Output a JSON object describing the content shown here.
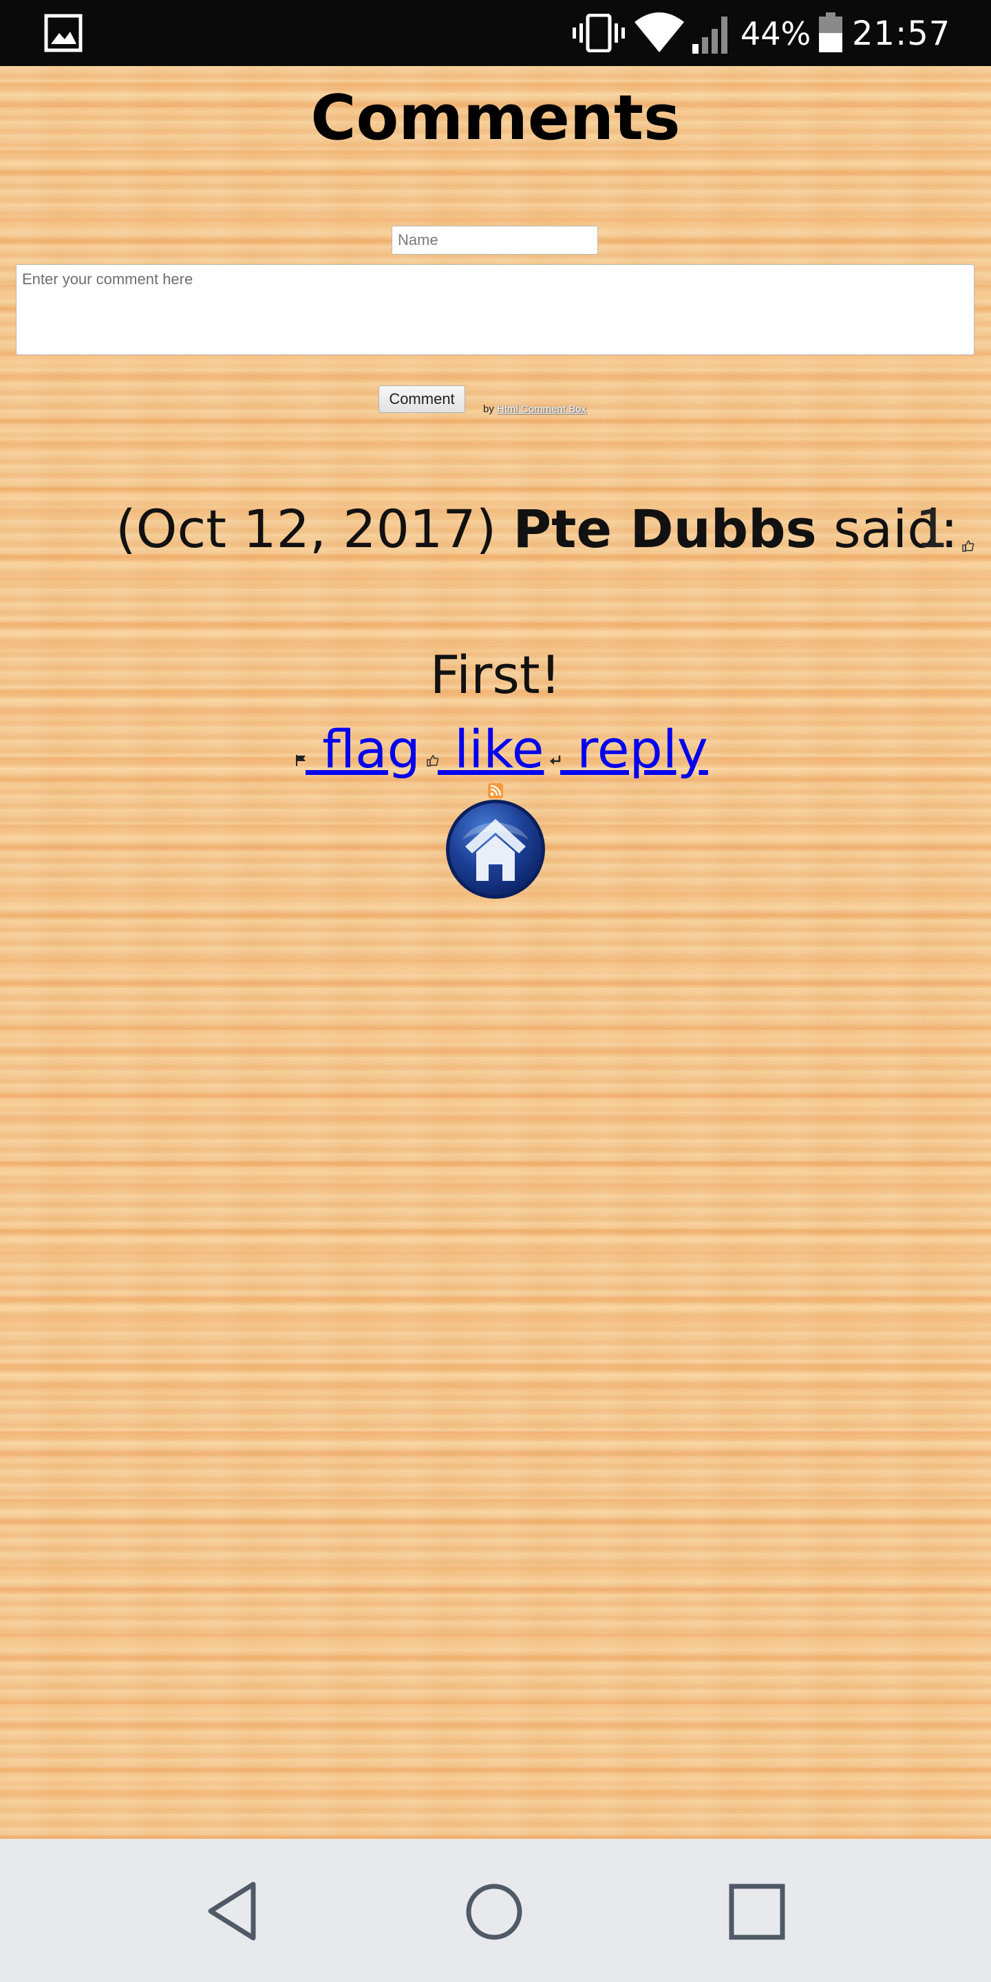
{
  "status_bar": {
    "battery_percent": "44%",
    "time": "21:57",
    "icons": [
      "gallery-icon",
      "vibrate-icon",
      "wifi-icon",
      "signal-icon",
      "battery-icon"
    ],
    "battery_level": 0.44
  },
  "page": {
    "title": "Comments",
    "background": "wood-texture"
  },
  "form": {
    "name_placeholder": "Name",
    "name_value": "",
    "comment_placeholder": "Enter your comment here",
    "comment_value": "",
    "submit_label": "Comment",
    "credit_prefix": "by",
    "credit_link": "Html Comment Box"
  },
  "comments": [
    {
      "date": "(Oct 12, 2017)",
      "author": "Pte Dubbs",
      "said": "said:",
      "likes": "1",
      "body": "First!",
      "actions": {
        "flag": " flag",
        "like": " like",
        "reply": " reply"
      }
    }
  ],
  "colors": {
    "link": "#0000ee",
    "status_bar_bg": "#0a0a0a",
    "nav_bar_bg": "#e8e9ec",
    "wood": "#f4c890",
    "home_button": "#1c3f95"
  },
  "nav_bar": {
    "icons": [
      "back-icon",
      "home-circle-icon",
      "recent-apps-icon"
    ]
  },
  "misc_icons": [
    "rss-icon",
    "home-button-icon"
  ]
}
